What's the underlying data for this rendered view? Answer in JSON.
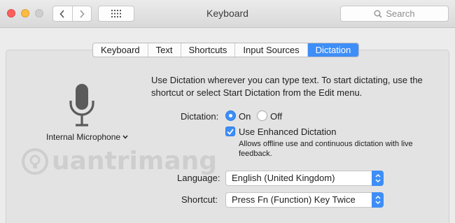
{
  "window": {
    "title": "Keyboard",
    "search_placeholder": "Search"
  },
  "tabs": [
    {
      "label": "Keyboard",
      "active": false
    },
    {
      "label": "Text",
      "active": false
    },
    {
      "label": "Shortcuts",
      "active": false
    },
    {
      "label": "Input Sources",
      "active": false
    },
    {
      "label": "Dictation",
      "active": true
    }
  ],
  "microphone": {
    "icon": "microphone-icon",
    "source": "Internal Microphone"
  },
  "intro": "Use Dictation wherever you can type text. To start dictating, use the shortcut or select Start Dictation from the Edit menu.",
  "dictation": {
    "label": "Dictation:",
    "on_label": "On",
    "off_label": "Off",
    "selected": "On"
  },
  "enhanced": {
    "label": "Use Enhanced Dictation",
    "checked": true,
    "note": "Allows offline use and continuous dictation with live feedback."
  },
  "language": {
    "label": "Language:",
    "value": "English (United Kingdom)"
  },
  "shortcut": {
    "label": "Shortcut:",
    "value": "Press Fn (Function) Key Twice"
  },
  "watermark": {
    "text": "uantrimang"
  },
  "colors": {
    "accent": "#3e8ef7",
    "close": "#fc605c",
    "minimize": "#fdbc40",
    "zoom_disabled": "#cfcfcf"
  }
}
